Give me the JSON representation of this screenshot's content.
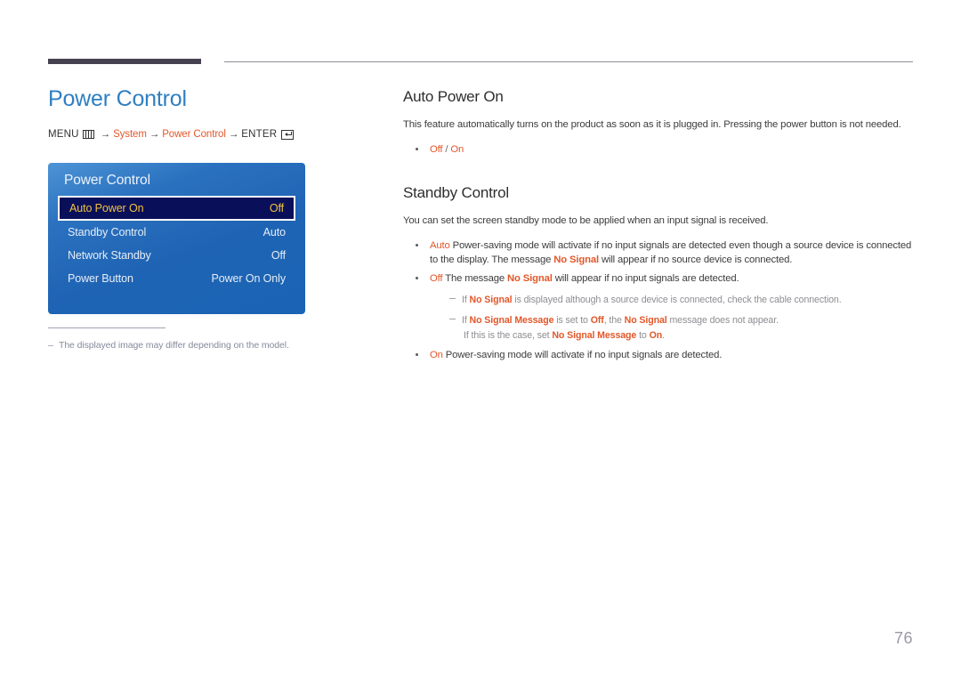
{
  "page": {
    "number": "76"
  },
  "left": {
    "title": "Power Control",
    "menu_path": {
      "menu_label": "MENU",
      "arrow1": "→",
      "system_label": "System",
      "arrow2": "→",
      "power_control_label": "Power Control",
      "arrow3": "→",
      "enter_label": "ENTER"
    },
    "osd": {
      "title": "Power Control",
      "rows": [
        {
          "label": "Auto Power On",
          "value": "Off",
          "selected": true
        },
        {
          "label": "Standby Control",
          "value": "Auto",
          "selected": false
        },
        {
          "label": "Network Standby",
          "value": "Off",
          "selected": false
        },
        {
          "label": "Power Button",
          "value": "Power On Only",
          "selected": false
        }
      ]
    },
    "footnote": {
      "dash": "–",
      "text": "The displayed image may differ depending on the model."
    }
  },
  "right": {
    "auto_power_on": {
      "heading": "Auto Power On",
      "description": "This feature automatically turns on the product as soon as it is plugged in. Pressing the power button is not needed.",
      "option_off": "Off",
      "option_separator": "/",
      "option_on": "On"
    },
    "standby_control": {
      "heading": "Standby Control",
      "description": "You can set the screen standby mode to be applied when an input signal is received.",
      "auto": {
        "label": "Auto",
        "line1": "Power-saving mode will activate if no input signals are detected even though a source device is connected to the display.",
        "line2_pre": "The message ",
        "line2_accent": "No Signal",
        "line2_post": " will appear if no source device is connected."
      },
      "off": {
        "label": "Off",
        "line1_pre": "The message ",
        "line1_accent": "No Signal",
        "line1_post": " will appear if no input signals are detected.",
        "notes": [
          {
            "pre": "If ",
            "a1": "No Signal",
            "mid": " is displayed although a source device is connected, check the cable connection."
          },
          {
            "pre": "If ",
            "a1": "No Signal Message",
            "mid": " is set to ",
            "a2": "Off",
            "mid2": ", the ",
            "a3": "No Signal",
            "post": " message does not appear.",
            "cont_pre": "If this is the case, set ",
            "cont_a1": "No Signal Message",
            "cont_mid": " to ",
            "cont_a2": "On",
            "cont_post": "."
          }
        ]
      },
      "on": {
        "label": "On",
        "line1": "Power-saving mode will activate if no input signals are detected."
      }
    }
  },
  "colors": {
    "title_blue": "#2f7fc1",
    "accent_orange": "#e2572a",
    "osd_blue": "#2a71bf",
    "osd_selected_bg": "#0a0f5a",
    "osd_selected_text": "#f0c33c",
    "rule_dark": "#45414f"
  }
}
